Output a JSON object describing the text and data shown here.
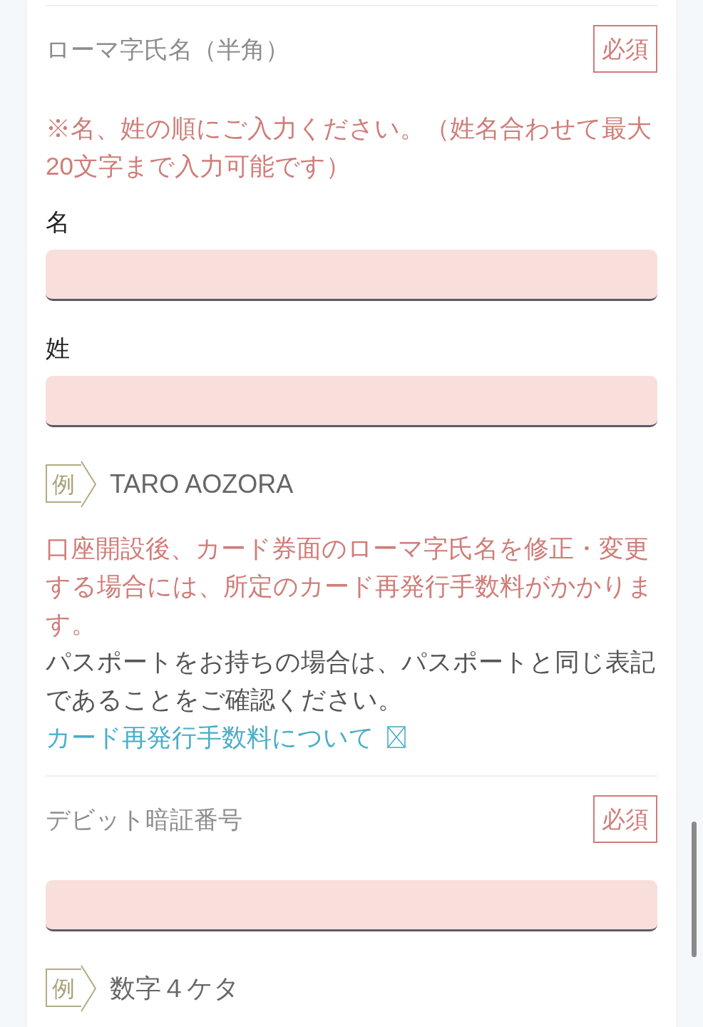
{
  "sections": [
    {
      "title": "ローマ字氏名（半角）",
      "required_badge": "必須",
      "note": "※名、姓の順にご入力ください。（姓名合わせて最大20文字まで入力可能です）",
      "fields": [
        {
          "kind": "input",
          "label": "名"
        },
        {
          "kind": "input",
          "label": "姓"
        }
      ],
      "example": {
        "tag": "例",
        "text": "TARO AOZORA"
      },
      "warning": "口座開設後、カード券面のローマ字氏名を修正・変更する場合には、所定のカード再発行手数料がかかります。",
      "info": "パスポートをお持ちの場合は、パスポートと同じ表記であることをご確認ください。",
      "link": "カード再発行手数料について"
    },
    {
      "title": "デビット暗証番号",
      "required_badge": "必須",
      "fields": [
        {
          "kind": "input"
        }
      ],
      "example": {
        "tag": "例",
        "text": "数字４ケタ"
      }
    }
  ]
}
